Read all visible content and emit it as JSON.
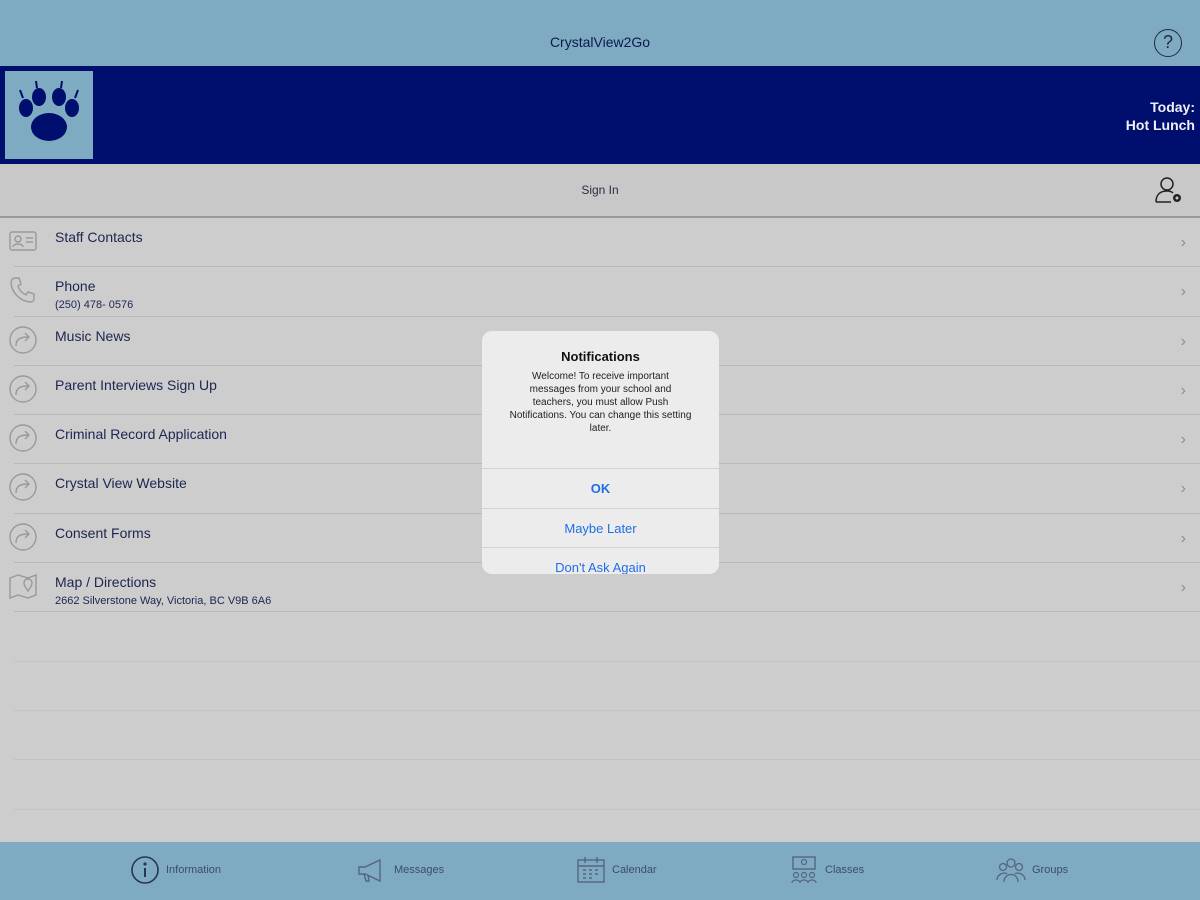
{
  "header": {
    "title": "CrystalView2Go",
    "help_icon": "help-circle-icon"
  },
  "banner": {
    "today_label": "Today:",
    "today_value": "Hot Lunch",
    "logo_icon": "paw-print-icon",
    "background": "#000e6e"
  },
  "signin": {
    "label": "Sign In",
    "icon": "user-settings-icon"
  },
  "list": {
    "items": [
      {
        "label": "Staff Contacts",
        "sub": "",
        "icon": "contact-card-icon"
      },
      {
        "label": "Phone",
        "sub": "(250) 478- 0576",
        "icon": "phone-icon"
      },
      {
        "label": "Music News",
        "sub": "",
        "icon": "share-arrow-icon"
      },
      {
        "label": "Parent Interviews Sign Up",
        "sub": "",
        "icon": "share-arrow-icon"
      },
      {
        "label": "Criminal Record Application",
        "sub": "",
        "icon": "share-arrow-icon"
      },
      {
        "label": "Crystal View Website",
        "sub": "",
        "icon": "share-arrow-icon"
      },
      {
        "label": "Consent Forms",
        "sub": "",
        "icon": "share-arrow-icon"
      },
      {
        "label": "Map / Directions",
        "sub": "2662 Silverstone Way, Victoria, BC V9B 6A6",
        "icon": "map-pin-icon"
      }
    ]
  },
  "tabs": [
    {
      "label": "Information",
      "icon": "info-circle-icon"
    },
    {
      "label": "Messages",
      "icon": "megaphone-icon"
    },
    {
      "label": "Calendar",
      "icon": "calendar-icon"
    },
    {
      "label": "Classes",
      "icon": "classes-icon"
    },
    {
      "label": "Groups",
      "icon": "groups-icon"
    }
  ],
  "dialog": {
    "title": "Notifications",
    "message": "Welcome! To receive important messages from your school and teachers, you must allow Push Notifications. You can change this setting later.",
    "buttons": {
      "ok": "OK",
      "later": "Maybe Later",
      "never": "Don't Ask Again"
    }
  },
  "colors": {
    "toolbar": "#7eabc1",
    "banner": "#000e6e",
    "link_blue": "#1f6ee8"
  }
}
